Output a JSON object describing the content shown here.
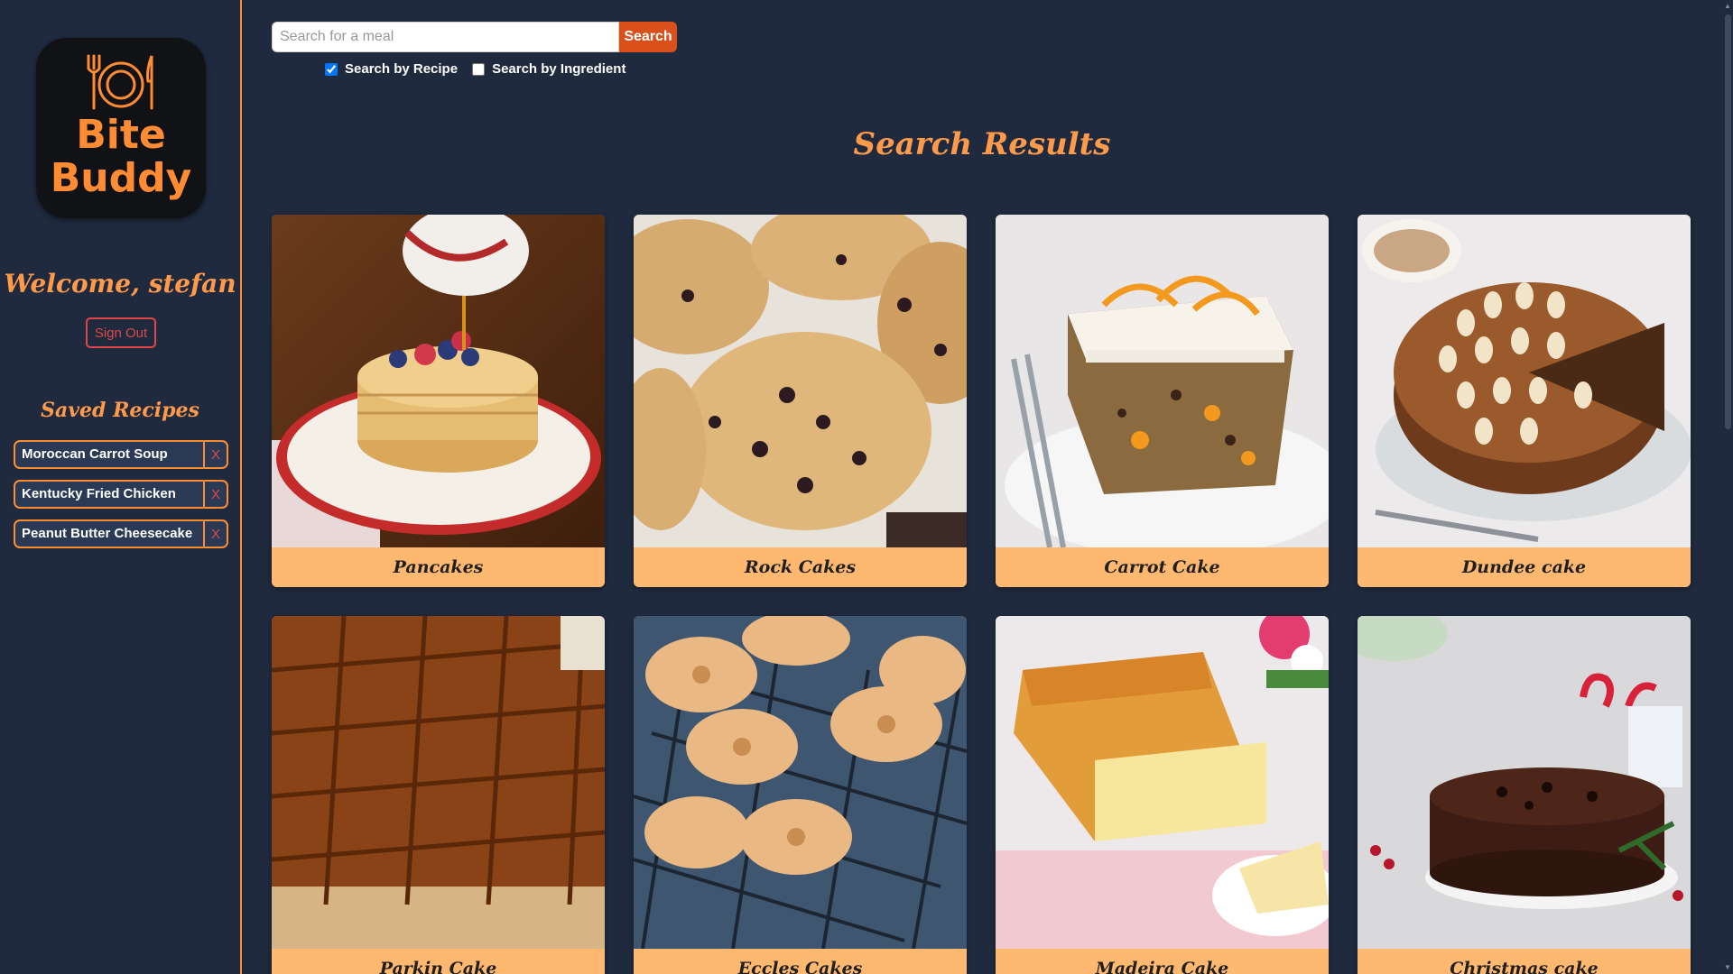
{
  "brand": {
    "name_line1": "Bite",
    "name_line2": "Buddy",
    "icon": "plate-fork-knife-icon",
    "accent_color": "#ff8c33"
  },
  "sidebar": {
    "welcome": "Welcome, stefan",
    "sign_out_label": "Sign Out",
    "saved_title": "Saved Recipes",
    "saved_recipes": [
      {
        "name": "Moroccan Carrot Soup",
        "remove_label": "X"
      },
      {
        "name": "Kentucky Fried Chicken",
        "remove_label": "X"
      },
      {
        "name": "Peanut Butter Cheesecake",
        "remove_label": "X"
      }
    ]
  },
  "search": {
    "placeholder": "Search for a meal",
    "value": "",
    "button_label": "Search",
    "filters": [
      {
        "label": "Search by Recipe",
        "checked": true
      },
      {
        "label": "Search by Ingredient",
        "checked": false
      }
    ]
  },
  "results": {
    "title": "Search Results",
    "cards": [
      {
        "title": "Pancakes",
        "image": "pancakes-photo"
      },
      {
        "title": "Rock Cakes",
        "image": "rock-cakes-photo"
      },
      {
        "title": "Carrot Cake",
        "image": "carrot-cake-photo"
      },
      {
        "title": "Dundee cake",
        "image": "dundee-cake-photo"
      },
      {
        "title": "Parkin Cake",
        "image": "parkin-cake-photo"
      },
      {
        "title": "Eccles Cakes",
        "image": "eccles-cakes-photo"
      },
      {
        "title": "Madeira Cake",
        "image": "madeira-cake-photo"
      },
      {
        "title": "Christmas cake",
        "image": "christmas-cake-photo"
      }
    ]
  },
  "colors": {
    "background": "#1f2a3e",
    "heading": "#ff9a4a",
    "card_footer": "#ffb870",
    "search_button": "#d9501b",
    "danger": "#e04848"
  }
}
